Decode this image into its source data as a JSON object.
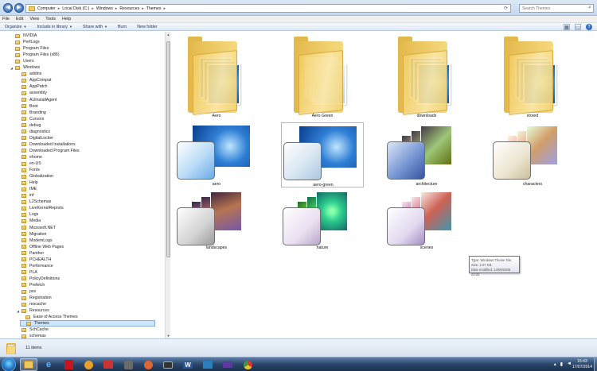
{
  "address_bar": {
    "breadcrumbs": [
      "Computer",
      "Local Disk (C:)",
      "Windows",
      "Resources",
      "Themes"
    ],
    "search_placeholder": "Search Themes"
  },
  "menu": [
    "File",
    "Edit",
    "View",
    "Tools",
    "Help"
  ],
  "command_bar": {
    "organize": "Organize",
    "include_in_library": "Include in library",
    "share_with": "Share with",
    "burn": "Burn",
    "new_folder": "New folder"
  },
  "tree": [
    {
      "label": "NVIDIA",
      "level": 1
    },
    {
      "label": "PerfLogs",
      "level": 1
    },
    {
      "label": "Program Files",
      "level": 1
    },
    {
      "label": "Program Files (x86)",
      "level": 1
    },
    {
      "label": "Users",
      "level": 1
    },
    {
      "label": "Windows",
      "level": 1,
      "expanded": true
    },
    {
      "label": "addins",
      "level": 2
    },
    {
      "label": "AppCompat",
      "level": 2
    },
    {
      "label": "AppPatch",
      "level": 2
    },
    {
      "label": "assembly",
      "level": 2
    },
    {
      "label": "AUInstallAgent",
      "level": 2
    },
    {
      "label": "Boot",
      "level": 2
    },
    {
      "label": "Branding",
      "level": 2
    },
    {
      "label": "Cursors",
      "level": 2
    },
    {
      "label": "debug",
      "level": 2
    },
    {
      "label": "diagnostics",
      "level": 2
    },
    {
      "label": "DigitalLocker",
      "level": 2
    },
    {
      "label": "Downloaded Installations",
      "level": 2
    },
    {
      "label": "Downloaded Program Files",
      "level": 2
    },
    {
      "label": "ehome",
      "level": 2
    },
    {
      "label": "en-US",
      "level": 2
    },
    {
      "label": "Fonts",
      "level": 2
    },
    {
      "label": "Globalization",
      "level": 2
    },
    {
      "label": "Help",
      "level": 2
    },
    {
      "label": "IME",
      "level": 2
    },
    {
      "label": "inf",
      "level": 2
    },
    {
      "label": "L2Schemas",
      "level": 2
    },
    {
      "label": "LiveKernelReports",
      "level": 2
    },
    {
      "label": "Logs",
      "level": 2
    },
    {
      "label": "Media",
      "level": 2
    },
    {
      "label": "Microsoft.NET",
      "level": 2
    },
    {
      "label": "Migration",
      "level": 2
    },
    {
      "label": "ModemLogs",
      "level": 2
    },
    {
      "label": "Offline Web Pages",
      "level": 2
    },
    {
      "label": "Panther",
      "level": 2
    },
    {
      "label": "PCHEALTH",
      "level": 2
    },
    {
      "label": "Performance",
      "level": 2
    },
    {
      "label": "PLA",
      "level": 2
    },
    {
      "label": "PolicyDefinitions",
      "level": 2
    },
    {
      "label": "Prefetch",
      "level": 2
    },
    {
      "label": "pss",
      "level": 2
    },
    {
      "label": "Registration",
      "level": 2
    },
    {
      "label": "rescache",
      "level": 2
    },
    {
      "label": "Resources",
      "level": 2,
      "expanded": true
    },
    {
      "label": "Ease of Access Themes",
      "level": 3
    },
    {
      "label": "Themes",
      "level": 3,
      "selected": true
    },
    {
      "label": "SchCache",
      "level": 2
    },
    {
      "label": "schemas",
      "level": 2
    }
  ],
  "items": [
    {
      "label": "Aero",
      "kind": "folder"
    },
    {
      "label": "Aero Green",
      "kind": "folder"
    },
    {
      "label": "downloads",
      "kind": "folder"
    },
    {
      "label": "stored",
      "kind": "folder"
    },
    {
      "label": "aero",
      "kind": "theme"
    },
    {
      "label": "aero-green",
      "kind": "theme"
    },
    {
      "label": "architecture",
      "kind": "theme"
    },
    {
      "label": "characters",
      "kind": "theme"
    },
    {
      "label": "landscapes",
      "kind": "theme"
    },
    {
      "label": "nature",
      "kind": "theme"
    },
    {
      "label": "scenes",
      "kind": "theme"
    }
  ],
  "tooltip": {
    "line1": "Type: Windows Theme File",
    "line2": "Size: 2.07 KB",
    "line3": "Date modified: 14/06/2009 22:32"
  },
  "status": {
    "count": "11 items"
  },
  "clock": {
    "time": "15:43",
    "date": "17/07/2014"
  },
  "colors": {
    "accent": "#2c62a8",
    "taskbar": "#2a4569",
    "selection": "#cde6fb"
  }
}
